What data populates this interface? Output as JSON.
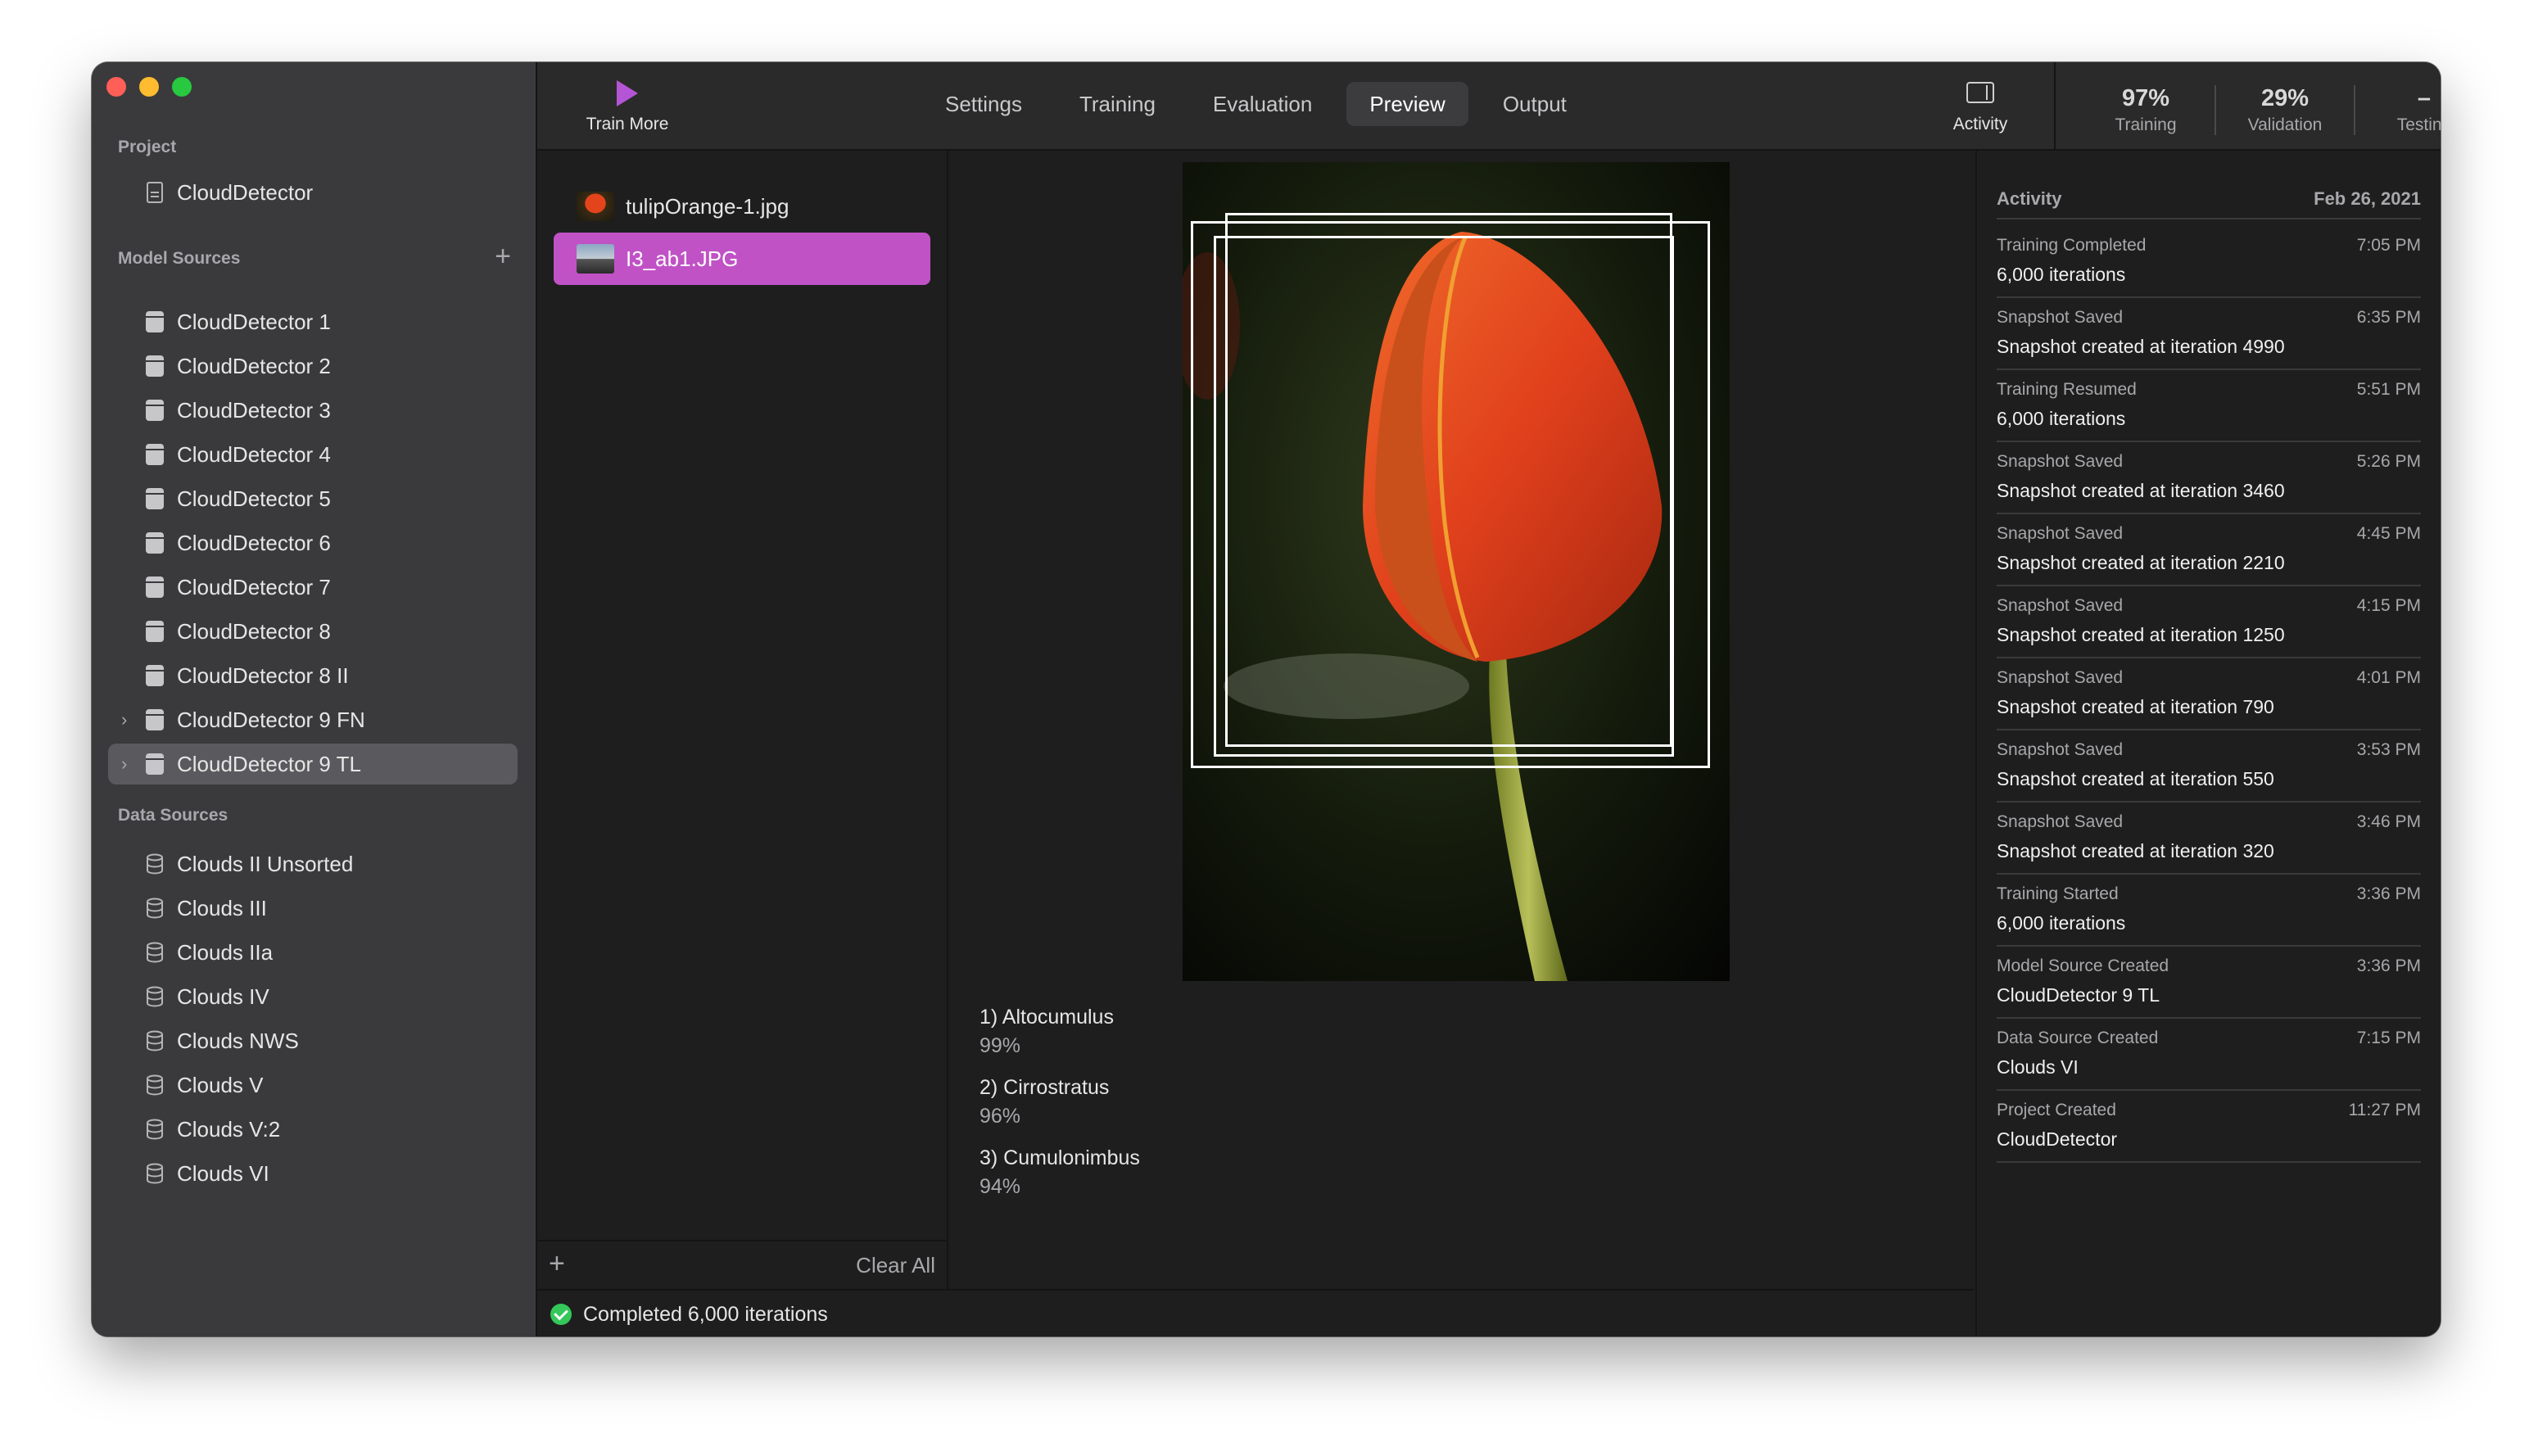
{
  "sidebar": {
    "project_title": "Project",
    "project_item": "CloudDetector",
    "model_sources_title": "Model Sources",
    "add_symbol": "+",
    "model_sources": [
      {
        "label": "CloudDetector 1",
        "expandable": false
      },
      {
        "label": "CloudDetector 2",
        "expandable": false
      },
      {
        "label": "CloudDetector 3",
        "expandable": false
      },
      {
        "label": "CloudDetector 4",
        "expandable": false
      },
      {
        "label": "CloudDetector 5",
        "expandable": false
      },
      {
        "label": "CloudDetector 6",
        "expandable": false
      },
      {
        "label": "CloudDetector 7",
        "expandable": false
      },
      {
        "label": "CloudDetector 8",
        "expandable": false
      },
      {
        "label": "CloudDetector 8 II",
        "expandable": false
      },
      {
        "label": "CloudDetector 9 FN",
        "expandable": true
      },
      {
        "label": "CloudDetector 9 TL",
        "expandable": true,
        "selected": true
      }
    ],
    "data_sources_title": "Data Sources",
    "data_sources": [
      "Clouds II Unsorted",
      "Clouds III",
      "Clouds IIa",
      "Clouds IV",
      "Clouds NWS",
      "Clouds V",
      "Clouds V:2",
      "Clouds VI"
    ]
  },
  "toolbar": {
    "train_more": "Train More",
    "tabs": [
      "Settings",
      "Training",
      "Evaluation",
      "Preview",
      "Output"
    ],
    "active_tab": "Preview",
    "activity": "Activity",
    "metrics": [
      {
        "value": "97%",
        "label": "Training"
      },
      {
        "value": "29%",
        "label": "Validation"
      },
      {
        "value": "–",
        "label": "Testing"
      }
    ]
  },
  "files": {
    "items": [
      {
        "name": "tulipOrange-1.jpg",
        "selected": false
      },
      {
        "name": "I3_ab1.JPG",
        "selected": true
      }
    ],
    "add": "+",
    "clear_all": "Clear All"
  },
  "preview": {
    "results": [
      {
        "name": "1) Altocumulus",
        "confidence": "99%"
      },
      {
        "name": "2) Cirrostratus",
        "confidence": "96%"
      },
      {
        "name": "3) Cumulonimbus",
        "confidence": "94%"
      }
    ]
  },
  "status": {
    "text": "Completed 6,000 iterations"
  },
  "activity": {
    "title": "Activity",
    "date": "Feb 26, 2021",
    "events": [
      {
        "type": "Training Completed",
        "time": "7:05 PM",
        "detail": "6,000 iterations"
      },
      {
        "type": "Snapshot Saved",
        "time": "6:35 PM",
        "detail": "Snapshot created at iteration 4990"
      },
      {
        "type": "Training Resumed",
        "time": "5:51 PM",
        "detail": "6,000 iterations"
      },
      {
        "type": "Snapshot Saved",
        "time": "5:26 PM",
        "detail": "Snapshot created at iteration 3460"
      },
      {
        "type": "Snapshot Saved",
        "time": "4:45 PM",
        "detail": "Snapshot created at iteration 2210"
      },
      {
        "type": "Snapshot Saved",
        "time": "4:15 PM",
        "detail": "Snapshot created at iteration 1250"
      },
      {
        "type": "Snapshot Saved",
        "time": "4:01 PM",
        "detail": "Snapshot created at iteration 790"
      },
      {
        "type": "Snapshot Saved",
        "time": "3:53 PM",
        "detail": "Snapshot created at iteration 550"
      },
      {
        "type": "Snapshot Saved",
        "time": "3:46 PM",
        "detail": "Snapshot created at iteration 320"
      },
      {
        "type": "Training Started",
        "time": "3:36 PM",
        "detail": "6,000 iterations"
      },
      {
        "type": "Model Source Created",
        "time": "3:36 PM",
        "detail": "CloudDetector 9 TL"
      },
      {
        "type": "Data Source Created",
        "time": "7:15 PM",
        "detail": "Clouds VI"
      },
      {
        "type": "Project Created",
        "time": "11:27 PM",
        "detail": "CloudDetector"
      }
    ]
  },
  "colors": {
    "accent": "#c052c6",
    "play": "#b455d6",
    "success": "#34c759"
  }
}
